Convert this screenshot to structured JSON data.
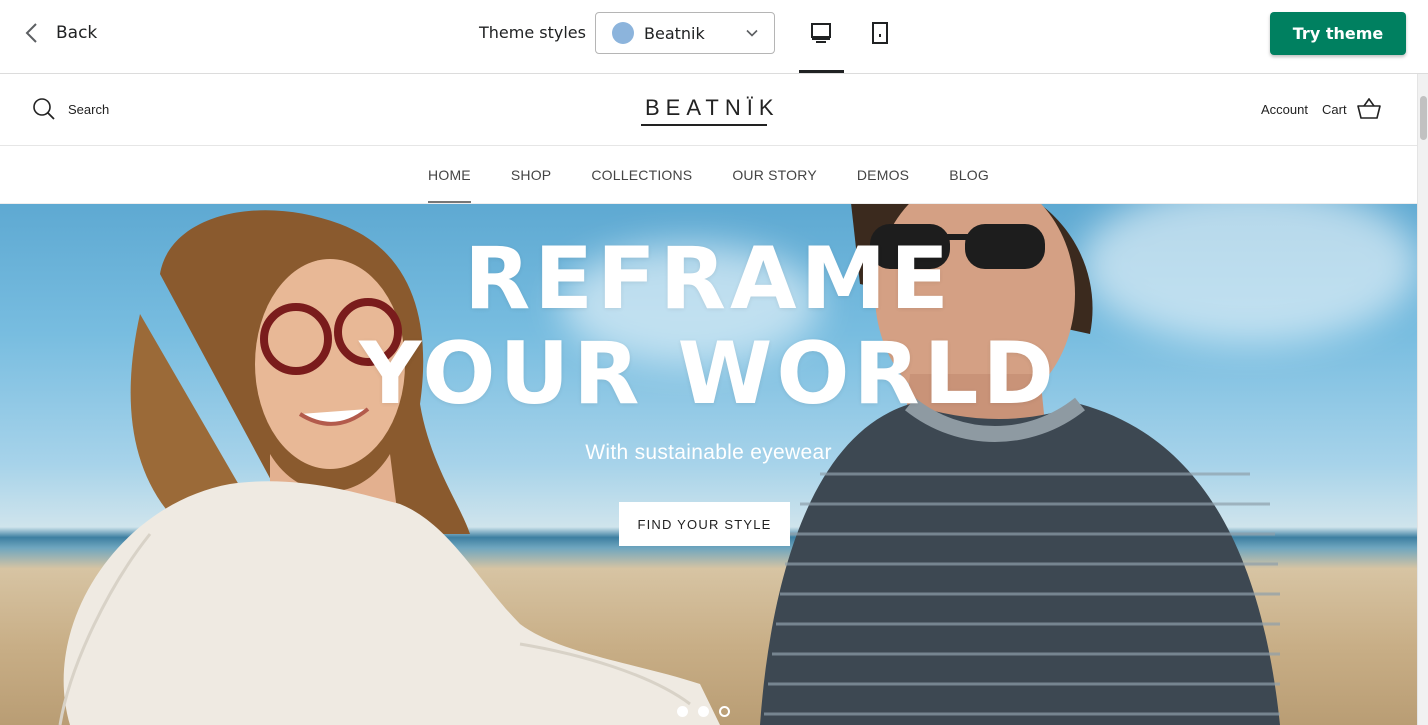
{
  "toolbar": {
    "back_label": "Back",
    "theme_styles_label": "Theme styles",
    "selected_style": "Beatnik",
    "swatch_color": "#8cb4dc",
    "active_device": "desktop",
    "try_theme_label": "Try theme",
    "try_theme_color": "#008060"
  },
  "store": {
    "search_label": "Search",
    "logo_text": "BEATNÏK",
    "account_label": "Account",
    "cart_label": "Cart",
    "nav": [
      {
        "label": "HOME",
        "active": true
      },
      {
        "label": "SHOP"
      },
      {
        "label": "COLLECTIONS"
      },
      {
        "label": "OUR STORY"
      },
      {
        "label": "DEMOS"
      },
      {
        "label": "BLOG"
      }
    ]
  },
  "hero": {
    "title_line1": "REFRAME",
    "title_line2": "YOUR WORLD",
    "subtitle": "With sustainable eyewear",
    "cta_label": "FIND YOUR STYLE",
    "slides_total": 3,
    "active_slide": 2
  }
}
